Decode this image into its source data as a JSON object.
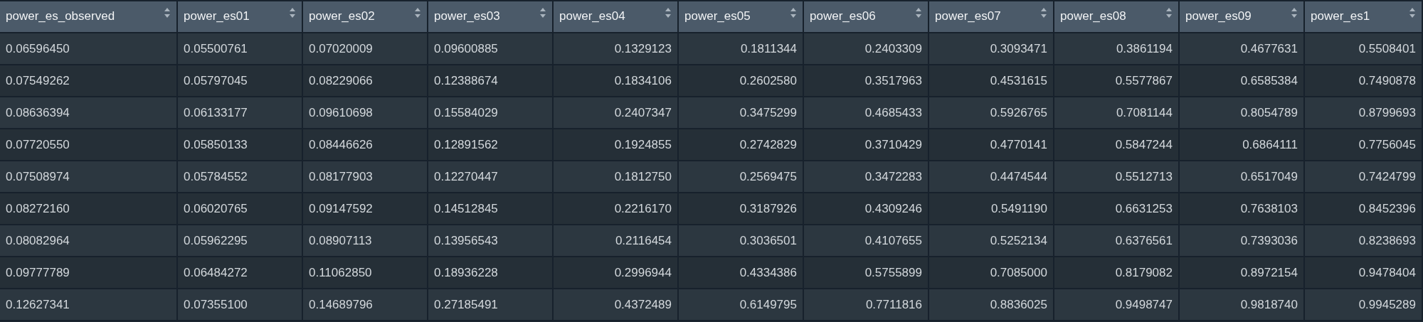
{
  "table": {
    "columns": [
      {
        "label": "power_es_observed",
        "kind": "text"
      },
      {
        "label": "power_es01",
        "kind": "text"
      },
      {
        "label": "power_es02",
        "kind": "text"
      },
      {
        "label": "power_es03",
        "kind": "text"
      },
      {
        "label": "power_es04",
        "kind": "number"
      },
      {
        "label": "power_es05",
        "kind": "number"
      },
      {
        "label": "power_es06",
        "kind": "number"
      },
      {
        "label": "power_es07",
        "kind": "number"
      },
      {
        "label": "power_es08",
        "kind": "number"
      },
      {
        "label": "power_es09",
        "kind": "number"
      },
      {
        "label": "power_es1",
        "kind": "number"
      }
    ],
    "rows": [
      [
        "0.06596450",
        "0.05500761",
        "0.07020009",
        "0.09600885",
        "0.1329123",
        "0.1811344",
        "0.2403309",
        "0.3093471",
        "0.3861194",
        "0.4677631",
        "0.5508401"
      ],
      [
        "0.07549262",
        "0.05797045",
        "0.08229066",
        "0.12388674",
        "0.1834106",
        "0.2602580",
        "0.3517963",
        "0.4531615",
        "0.5577867",
        "0.6585384",
        "0.7490878"
      ],
      [
        "0.08636394",
        "0.06133177",
        "0.09610698",
        "0.15584029",
        "0.2407347",
        "0.3475299",
        "0.4685433",
        "0.5926765",
        "0.7081144",
        "0.8054789",
        "0.8799693"
      ],
      [
        "0.07720550",
        "0.05850133",
        "0.08446626",
        "0.12891562",
        "0.1924855",
        "0.2742829",
        "0.3710429",
        "0.4770141",
        "0.5847244",
        "0.6864111",
        "0.7756045"
      ],
      [
        "0.07508974",
        "0.05784552",
        "0.08177903",
        "0.12270447",
        "0.1812750",
        "0.2569475",
        "0.3472283",
        "0.4474544",
        "0.5512713",
        "0.6517049",
        "0.7424799"
      ],
      [
        "0.08272160",
        "0.06020765",
        "0.09147592",
        "0.14512845",
        "0.2216170",
        "0.3187926",
        "0.4309246",
        "0.5491190",
        "0.6631253",
        "0.7638103",
        "0.8452396"
      ],
      [
        "0.08082964",
        "0.05962295",
        "0.08907113",
        "0.13956543",
        "0.2116454",
        "0.3036501",
        "0.4107655",
        "0.5252134",
        "0.6376561",
        "0.7393036",
        "0.8238693"
      ],
      [
        "0.09777789",
        "0.06484272",
        "0.11062850",
        "0.18936228",
        "0.2996944",
        "0.4334386",
        "0.5755899",
        "0.7085000",
        "0.8179082",
        "0.8972154",
        "0.9478404"
      ],
      [
        "0.12627341",
        "0.07355100",
        "0.14689796",
        "0.27185491",
        "0.4372489",
        "0.6149795",
        "0.7711816",
        "0.8836025",
        "0.9498747",
        "0.9818740",
        "0.9945289"
      ]
    ]
  }
}
